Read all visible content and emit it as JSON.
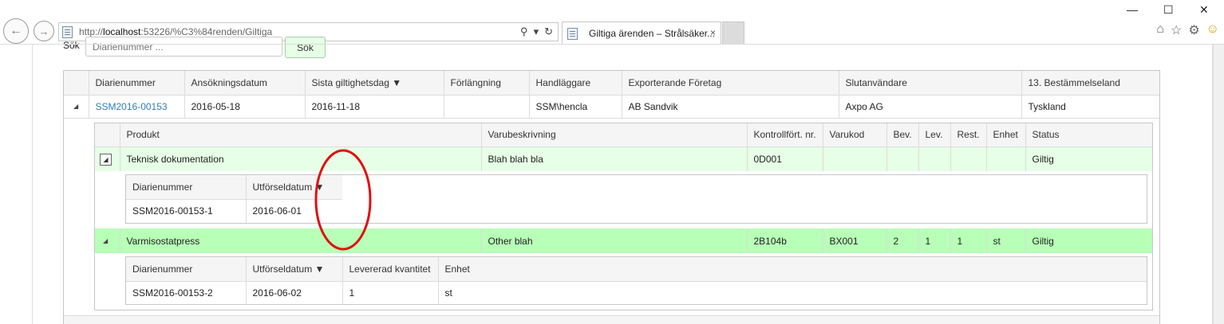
{
  "browser": {
    "url_prefix": "http://",
    "url_host": "localhost",
    "url_rest": ":53226/%C3%84renden/Giltiga",
    "tab_title": "Giltiga ärenden – Strålsäker...",
    "tab_close": "×",
    "window_controls": {
      "minimize": "—",
      "maximize": "☐",
      "close": "✕"
    },
    "icons": [
      "back-arrow-icon",
      "forward-arrow-icon",
      "search-icon",
      "dropdown-icon",
      "refresh-icon",
      "home-icon",
      "star-icon",
      "gear-icon",
      "smiley-icon"
    ]
  },
  "search": {
    "label": "Sök",
    "placeholder": "Diarienummer ...",
    "button_label": "Sök"
  },
  "outer_grid": {
    "headers": [
      "Diarienummer",
      "Ansökningsdatum",
      "Sista giltighetsdag ▼",
      "Förlängning",
      "Handläggare",
      "Exporterande Företag",
      "Slutanvändare",
      "13. Bestämmelseland"
    ],
    "row": {
      "expander": "◢",
      "diarienummer": "SSM2016-00153",
      "ansokningsdatum": "2016-05-18",
      "sista_giltighetsdag": "2016-11-18",
      "forlangning": "",
      "handlaggare": "SSM\\hencla",
      "exporterande_foretag": "AB Sandvik",
      "slutanvandare": "Axpo AG",
      "bestammelseland": "Tyskland"
    }
  },
  "product_grid": {
    "headers": [
      "Produkt",
      "Varubeskrivning",
      "Kontrollfört. nr.",
      "Varukod",
      "Bev.",
      "Lev.",
      "Rest.",
      "Enhet",
      "Status"
    ],
    "rows": [
      {
        "expander": "◢",
        "produkt": "Teknisk dokumentation",
        "varubeskrivning": "Blah blah bla",
        "kontrollfort_nr": "0D001",
        "varukod": "",
        "bev": "",
        "lev": "",
        "rest": "",
        "enhet": "",
        "status": "Giltig",
        "sub": {
          "headers": [
            "Diarienummer",
            "Utförseldatum ▼"
          ],
          "rows": [
            [
              "SSM2016-00153-1",
              "2016-06-01"
            ]
          ]
        }
      },
      {
        "expander": "◢",
        "produkt": "Varmisostatpress",
        "varubeskrivning": "Other blah",
        "kontrollfort_nr": "2B104b",
        "varukod": "BX001",
        "bev": "2",
        "lev": "1",
        "rest": "1",
        "enhet": "st",
        "status": "Giltig",
        "sub": {
          "headers": [
            "Diarienummer",
            "Utförseldatum ▼",
            "Levererad kvantitet",
            "Enhet"
          ],
          "rows": [
            [
              "SSM2016-00153-2",
              "2016-06-02",
              "1",
              "st"
            ]
          ]
        }
      }
    ]
  },
  "colors": {
    "link": "#2e7cb7",
    "row_light": "#e6ffe6",
    "row_strong": "#b8ffb8",
    "annotation": "#e01010"
  }
}
